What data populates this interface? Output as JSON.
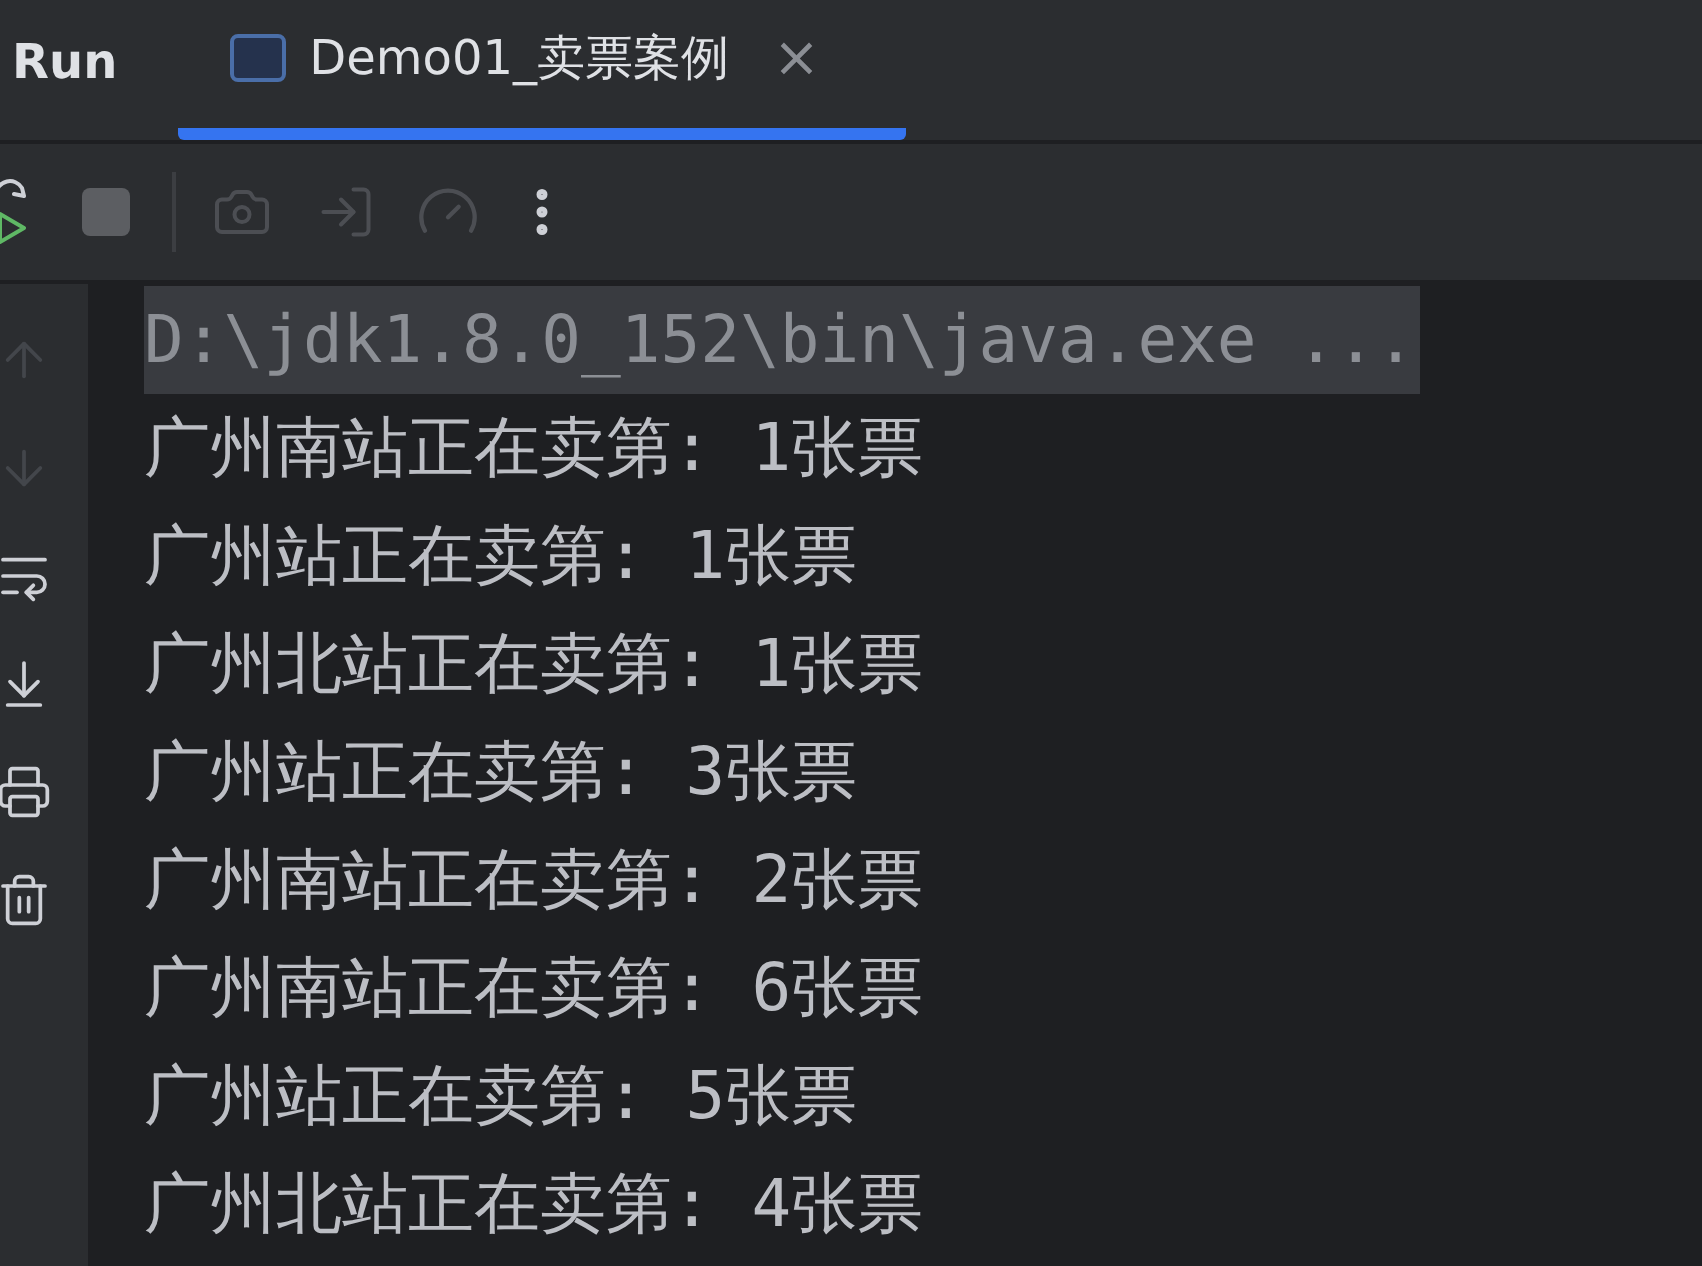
{
  "panel": {
    "title": "Run"
  },
  "tabs": [
    {
      "label": "Demo01_卖票案例",
      "selected": true,
      "close": "×"
    }
  ],
  "toolbar": [
    {
      "kind": "rerun",
      "disabled": false
    },
    {
      "kind": "stop",
      "disabled": false
    },
    {
      "kind": "separator"
    },
    {
      "kind": "camera",
      "disabled": true
    },
    {
      "kind": "enter",
      "disabled": true
    },
    {
      "kind": "gauge",
      "disabled": true
    },
    {
      "kind": "more",
      "disabled": false
    }
  ],
  "sidebar": [
    {
      "kind": "up",
      "disabled": true
    },
    {
      "kind": "down",
      "disabled": true
    },
    {
      "kind": "wrap",
      "disabled": false
    },
    {
      "kind": "scroll-end",
      "disabled": false
    },
    {
      "kind": "print",
      "disabled": false
    },
    {
      "kind": "trash",
      "disabled": false
    }
  ],
  "console": {
    "command": "D:\\jdk1.8.0_152\\bin\\java.exe ...",
    "lines": [
      "广州南站正在卖第: 1张票",
      "广州站正在卖第: 1张票",
      "广州北站正在卖第: 1张票",
      "广州站正在卖第: 3张票",
      "广州南站正在卖第: 2张票",
      "广州南站正在卖第: 6张票",
      "广州站正在卖第: 5张票",
      "广州北站正在卖第: 4张票"
    ]
  }
}
